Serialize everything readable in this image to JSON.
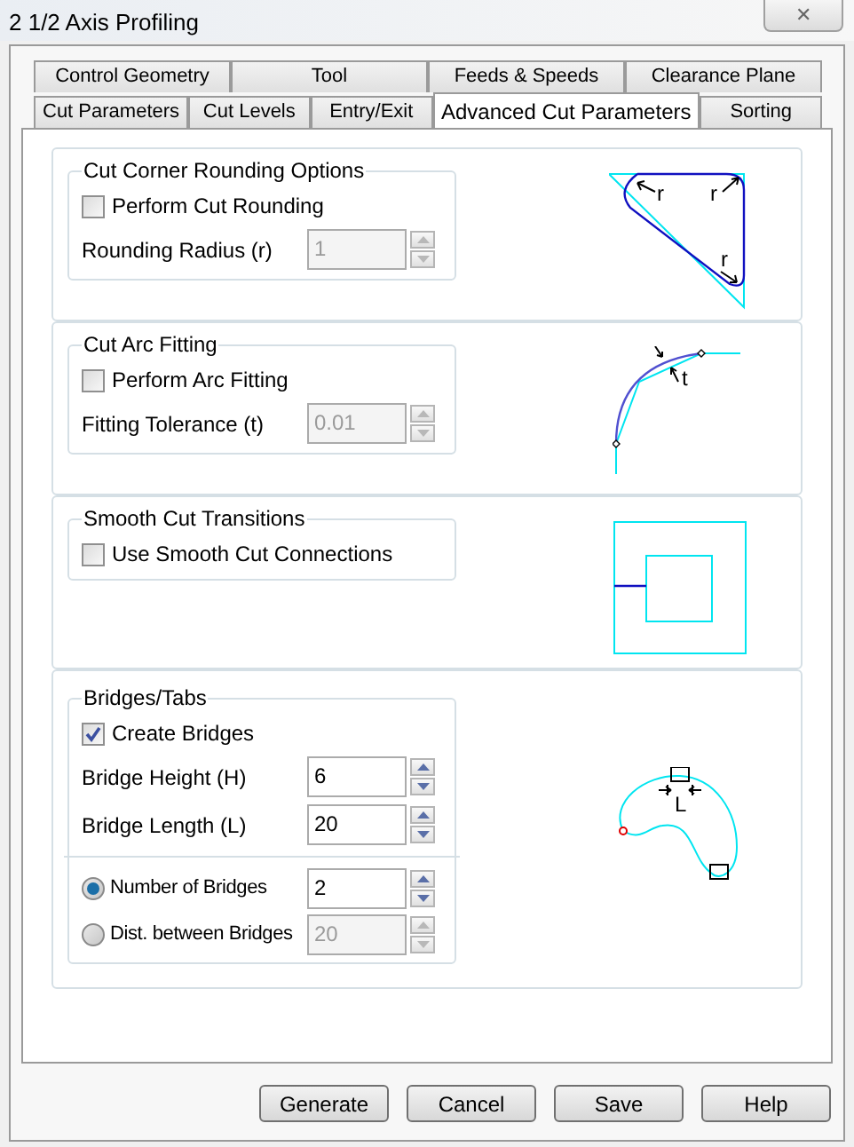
{
  "window": {
    "title": "2 1/2 Axis Profiling",
    "close": "✕"
  },
  "tab_rows": [
    [
      {
        "label": "Control Geometry",
        "selected": false
      },
      {
        "label": "Tool",
        "selected": false
      },
      {
        "label": "Feeds & Speeds",
        "selected": false
      },
      {
        "label": "Clearance Plane",
        "selected": false
      }
    ],
    [
      {
        "label": "Cut Parameters",
        "selected": false
      },
      {
        "label": "Cut Levels",
        "selected": false
      },
      {
        "label": "Entry/Exit",
        "selected": false
      },
      {
        "label": "Advanced Cut Parameters",
        "selected": true
      },
      {
        "label": "Sorting",
        "selected": false
      }
    ]
  ],
  "sections": [
    {
      "title": "Cut Corner Rounding Options",
      "diagram": {
        "kind": "corner-rounding",
        "labels": [
          "r",
          "r",
          "r"
        ]
      },
      "items": [
        {
          "kind": "checkbox",
          "label": "Perform Cut Rounding",
          "checked": false
        },
        {
          "kind": "spin",
          "label": "Rounding Radius (r)",
          "value": "1",
          "disabled": true
        }
      ]
    },
    {
      "title": "Cut Arc Fitting",
      "diagram": {
        "kind": "arc-fitting",
        "labels": [
          "t"
        ]
      },
      "items": [
        {
          "kind": "checkbox",
          "label": "Perform Arc Fitting",
          "checked": false
        },
        {
          "kind": "spin",
          "label": "Fitting Tolerance (t)",
          "value": "0.01",
          "disabled": true
        }
      ]
    },
    {
      "title": "Smooth Cut Transitions",
      "diagram": {
        "kind": "smooth",
        "labels": []
      },
      "items": [
        {
          "kind": "checkbox",
          "label": "Use Smooth Cut Connections",
          "checked": false
        }
      ]
    },
    {
      "title": "Bridges/Tabs",
      "diagram": {
        "kind": "bridges",
        "labels": [
          "L"
        ]
      },
      "items": [
        {
          "kind": "checkbox",
          "label": "Create Bridges",
          "checked": true
        },
        {
          "kind": "spin",
          "label": "Bridge Height (H)",
          "value": "6",
          "disabled": false
        },
        {
          "kind": "spin",
          "label": "Bridge Length (L)",
          "value": "20",
          "disabled": false
        },
        {
          "kind": "divider"
        },
        {
          "kind": "radio-spin",
          "label": "Number of Bridges",
          "selected": true,
          "value": "2",
          "disabled": false
        },
        {
          "kind": "radio-spin",
          "label": "Dist. between Bridges",
          "selected": false,
          "value": "20",
          "disabled": true
        }
      ]
    }
  ],
  "buttons": [
    "Generate",
    "Cancel",
    "Save",
    "Help"
  ]
}
